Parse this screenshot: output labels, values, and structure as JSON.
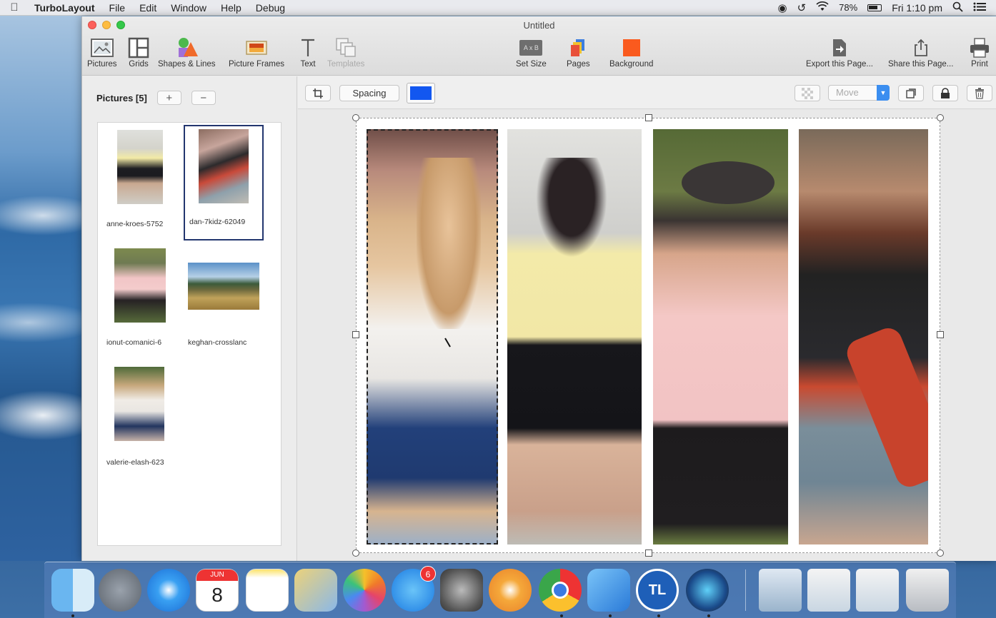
{
  "menubar": {
    "app_name": "TurboLayout",
    "menus": [
      "File",
      "Edit",
      "Window",
      "Help",
      "Debug"
    ],
    "battery": "78%",
    "clock": "Fri 1:10 pm"
  },
  "window": {
    "title": "Untitled"
  },
  "toolbar": {
    "pictures": "Pictures",
    "grids": "Grids",
    "shapes": "Shapes & Lines",
    "frames": "Picture Frames",
    "text": "Text",
    "templates": "Templates",
    "set_size": "Set Size",
    "set_size_icon_text": "A x B",
    "pages": "Pages",
    "background": "Background",
    "export": "Export this Page...",
    "share": "Share this Page...",
    "print": "Print",
    "background_color": "#fa5a1e"
  },
  "sidebar": {
    "title": "Pictures [5]",
    "add": "+",
    "remove": "−",
    "items": [
      {
        "caption": "anne-kroes-5752"
      },
      {
        "caption": "dan-7kidz-62049"
      },
      {
        "caption": "ionut-comanici-6"
      },
      {
        "caption": "keghan-crosslanc"
      },
      {
        "caption": "valerie-elash-623"
      }
    ]
  },
  "canvas_toolbar": {
    "spacing": "Spacing",
    "spacing_color": "#1257f0",
    "mode": "Move"
  },
  "dock": {
    "calendar_month": "JUN",
    "calendar_day": "8",
    "appstore_badge": "6",
    "teamviewer_label": "TL"
  }
}
